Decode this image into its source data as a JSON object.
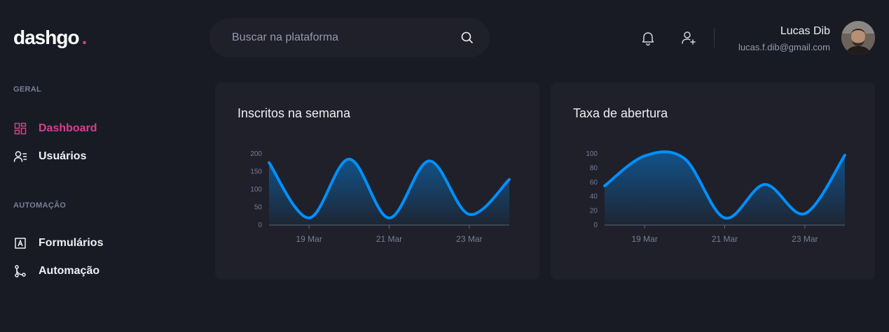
{
  "logo": {
    "text": "dashgo",
    "dot": "."
  },
  "search": {
    "placeholder": "Buscar na plataforma",
    "value": "",
    "icon": "search-icon"
  },
  "header": {
    "icons": [
      "bell-icon",
      "user-plus-icon"
    ],
    "profile": {
      "name": "Lucas Dib",
      "email": "lucas.f.dib@gmail.com"
    }
  },
  "sidebar": {
    "sections": [
      {
        "title": "GERAL",
        "items": [
          {
            "label": "Dashboard",
            "icon": "dashboard-icon",
            "active": true
          },
          {
            "label": "Usuários",
            "icon": "users-icon",
            "active": false
          }
        ]
      },
      {
        "title": "AUTOMAÇÃO",
        "items": [
          {
            "label": "Formulários",
            "icon": "form-icon",
            "active": false
          },
          {
            "label": "Automação",
            "icon": "git-merge-icon",
            "active": false
          }
        ]
      }
    ]
  },
  "colors": {
    "background": "#181b23",
    "card": "#1f2029",
    "accent": "#d53f8c",
    "series": "#0090ff"
  },
  "chart_data": [
    {
      "type": "area",
      "title": "Inscritos na semana",
      "x": [
        "2021-03-18",
        "2021-03-19",
        "2021-03-20",
        "2021-03-21",
        "2021-03-22",
        "2021-03-23",
        "2021-03-24"
      ],
      "series": [
        {
          "values": [
            175,
            20,
            185,
            20,
            180,
            30,
            128
          ]
        }
      ],
      "ylim": [
        0,
        200
      ],
      "yticks": [
        0,
        50,
        100,
        150,
        200
      ],
      "xtick_labels": [
        "19 Mar",
        "21 Mar",
        "23 Mar"
      ],
      "grid": false
    },
    {
      "type": "area",
      "title": "Taxa de abertura",
      "x": [
        "2021-03-18",
        "2021-03-19",
        "2021-03-20",
        "2021-03-21",
        "2021-03-22",
        "2021-03-23",
        "2021-03-24"
      ],
      "series": [
        {
          "values": [
            55,
            97,
            93,
            10,
            57,
            16,
            98
          ]
        }
      ],
      "ylim": [
        0,
        100
      ],
      "yticks": [
        0,
        20,
        40,
        60,
        80,
        100
      ],
      "xtick_labels": [
        "19 Mar",
        "21 Mar",
        "23 Mar"
      ],
      "grid": false
    }
  ]
}
